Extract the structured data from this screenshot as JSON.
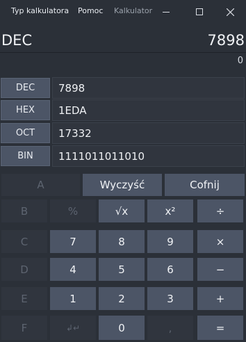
{
  "titlebar": {
    "menu_type": "Typ kalkulatora",
    "menu_help": "Pomoc",
    "app_title": "Kalkulator",
    "minimize": "–",
    "maximize": "☐",
    "close": "✕"
  },
  "display": {
    "mode": "DEC",
    "value": "7898",
    "memory": "0"
  },
  "bases": [
    {
      "label": "DEC",
      "value": "7898"
    },
    {
      "label": "HEX",
      "value": "1EDA"
    },
    {
      "label": "OCT",
      "value": "17332"
    },
    {
      "label": "BIN",
      "value": "1111011011010"
    }
  ],
  "top_row": {
    "a": "A",
    "clear": "Wyczyść",
    "back": "Cofnij"
  },
  "keys": {
    "b": "B",
    "percent": "%",
    "sqrt": "√x",
    "square": "x²",
    "divide": "÷",
    "c": "C",
    "seven": "7",
    "eight": "8",
    "nine": "9",
    "multiply": "×",
    "d": "D",
    "four": "4",
    "five": "5",
    "six": "6",
    "minus": "−",
    "e": "E",
    "one": "1",
    "two": "2",
    "three": "3",
    "plus": "+",
    "f": "F",
    "sign": "↲↵",
    "zero": "0",
    "dot": ",",
    "equals": "="
  }
}
